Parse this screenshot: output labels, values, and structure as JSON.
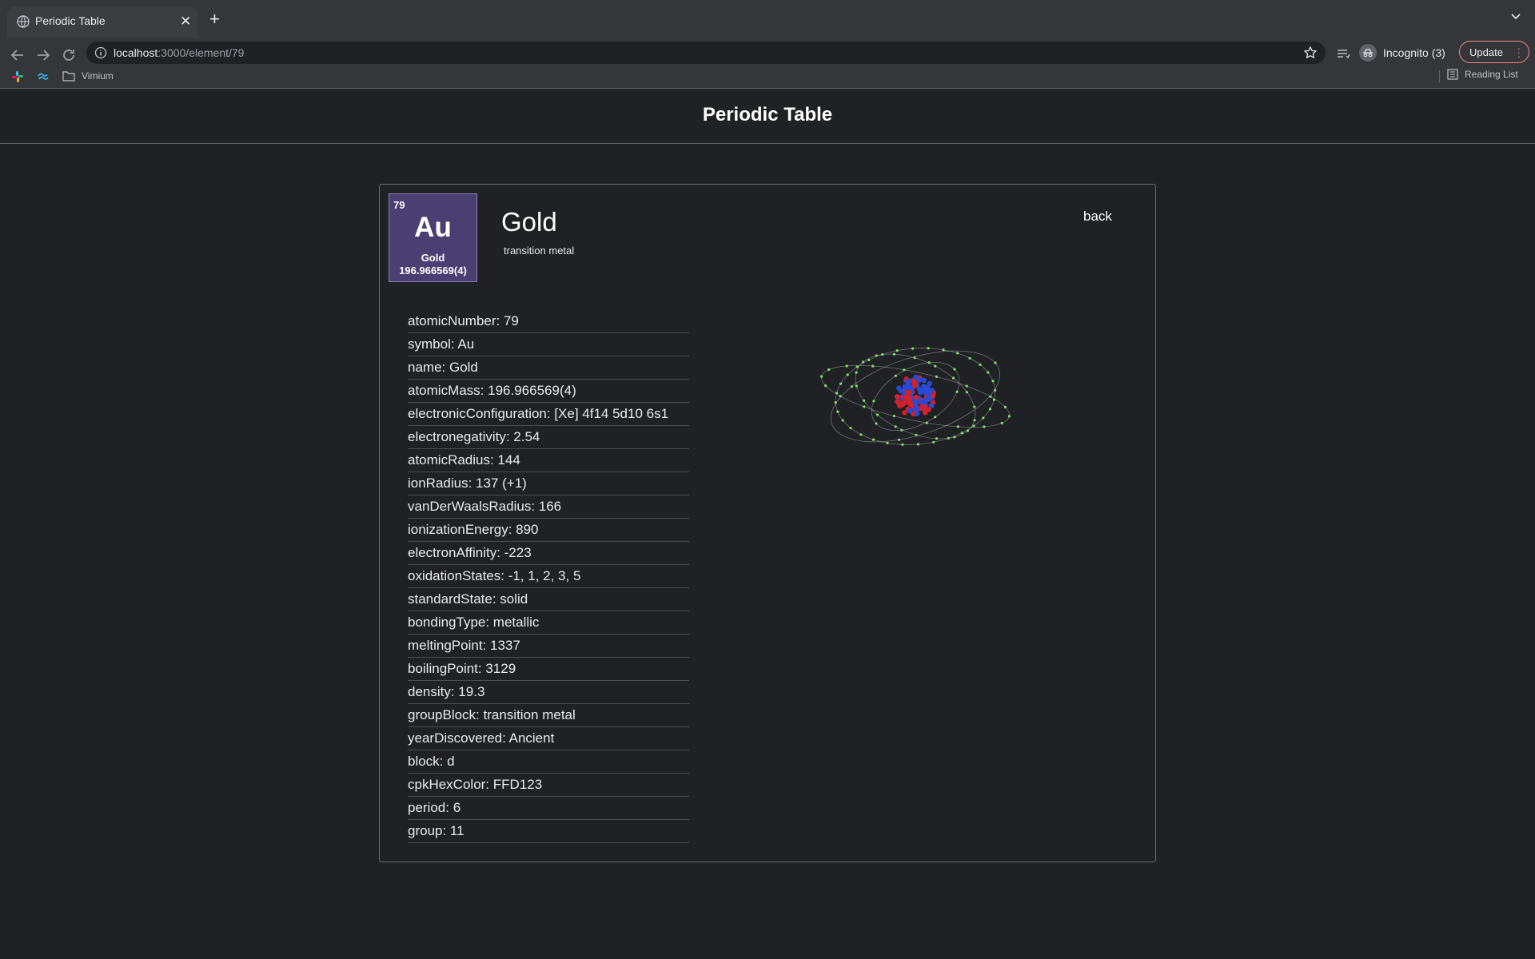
{
  "browser": {
    "tab_title": "Periodic Table",
    "url_host": "localhost",
    "url_path": ":3000/element/79",
    "profile_label": "Incognito (3)",
    "update_label": "Update",
    "bookmarks": [
      {
        "label": "Vimium"
      }
    ],
    "reading_list_label": "Reading List"
  },
  "page": {
    "title": "Periodic Table"
  },
  "element": {
    "tile": {
      "atomic_number": "79",
      "symbol": "Au",
      "name": "Gold",
      "mass": "196.966569(4)",
      "color": "#4a3f73"
    },
    "name": "Gold",
    "category": "transition metal",
    "back_label": "back",
    "properties": [
      "atomicNumber: 79",
      "symbol: Au",
      "name: Gold",
      "atomicMass: 196.966569(4)",
      "electronicConfiguration: [Xe] 4f14 5d10 6s1",
      "electronegativity: 2.54",
      "atomicRadius: 144",
      "ionRadius: 137 (+1)",
      "vanDerWaalsRadius: 166",
      "ionizationEnergy: 890",
      "electronAffinity: -223",
      "oxidationStates: -1, 1, 2, 3, 5",
      "standardState: solid",
      "bondingType: metallic",
      "meltingPoint: 1337",
      "boilingPoint: 3129",
      "density: 19.3",
      "groupBlock: transition metal",
      "yearDiscovered: Ancient",
      "block: d",
      "cpkHexColor: FFD123",
      "period: 6",
      "group: 11"
    ],
    "atom_colors": {
      "proton": "#d0222c",
      "neutron": "#2a49d6",
      "electron": "#7fe36a",
      "orbit": "#b0b3b8"
    }
  }
}
